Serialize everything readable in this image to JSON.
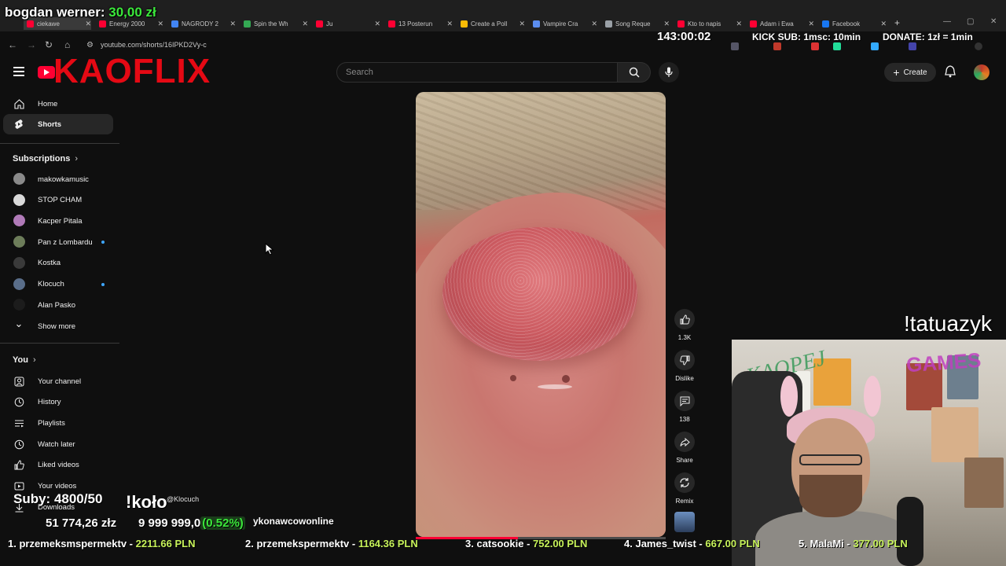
{
  "browser": {
    "tabs": [
      {
        "label": "ciekawe",
        "color": "#ff0033",
        "active": true
      },
      {
        "label": "Energy 2000",
        "color": "#ff0033"
      },
      {
        "label": "NAGRODY 2",
        "color": "#4285f4"
      },
      {
        "label": "Spin the Wh",
        "color": "#34a853"
      },
      {
        "label": "Ju",
        "color": "#ff0033"
      },
      {
        "label": "13 Posterun",
        "color": "#ff0033"
      },
      {
        "label": "Create a Poll",
        "color": "#fbbc05"
      },
      {
        "label": "Vampire Cra",
        "color": "#5b8def"
      },
      {
        "label": "Song Reque",
        "color": "#9aa0a6"
      },
      {
        "label": "Kto to napis",
        "color": "#ff0033"
      },
      {
        "label": "Adam i Ewa",
        "color": "#ff0033"
      },
      {
        "label": "Facebook",
        "color": "#1877f2"
      }
    ],
    "url": "youtube.com/shorts/16IPKD2Vy-c"
  },
  "header": {
    "brand_overlay": "KAOFLIX",
    "search_placeholder": "Search",
    "create_label": "Create"
  },
  "sidebar": {
    "main": [
      {
        "label": "Home",
        "icon": "home-icon"
      },
      {
        "label": "Shorts",
        "icon": "shorts-icon",
        "active": true
      }
    ],
    "subscriptions_heading": "Subscriptions",
    "subscriptions": [
      {
        "label": "makowkamusic",
        "color": "#8a8a8a",
        "live": false
      },
      {
        "label": "STOP CHAM",
        "color": "#d9d9d9",
        "live": false
      },
      {
        "label": "Kacper Pitala",
        "color": "#b07ab8",
        "live": false
      },
      {
        "label": "Pan z Lombardu",
        "color": "#6d7d5a",
        "live": true
      },
      {
        "label": "Kostka",
        "color": "#3a3a3a",
        "live": false
      },
      {
        "label": "Klocuch",
        "color": "#5a6e8a",
        "live": true
      },
      {
        "label": "Alan Pasko",
        "color": "#1c1c1c",
        "live": false
      }
    ],
    "show_more_label": "Show more",
    "you_heading": "You",
    "you_items": [
      {
        "label": "Your channel",
        "icon": "channel-icon"
      },
      {
        "label": "History",
        "icon": "history-icon"
      },
      {
        "label": "Playlists",
        "icon": "playlists-icon"
      },
      {
        "label": "Watch later",
        "icon": "watch-later-icon"
      },
      {
        "label": "Liked videos",
        "icon": "like-icon"
      },
      {
        "label": "Your videos",
        "icon": "your-videos-icon"
      },
      {
        "label": "Downloads",
        "icon": "download-icon"
      }
    ]
  },
  "short": {
    "likes": "1.3K",
    "dislike_label": "Dislike",
    "comments": "138",
    "share_label": "Share",
    "remix_label": "Remix",
    "progress_fraction": 0.41
  },
  "overlay": {
    "donor_name": "bogdan werner:",
    "donor_amount": "30,00 zł",
    "timer": "143:00:02",
    "kick_sub": "KICK SUB: 1msc: 10min",
    "donate_rate": "DONATE: 1zł = 1min",
    "command": "!tatuazyk",
    "subs": "Suby: 4800/50",
    "koto": "!koło",
    "author_handle": "@Klocuch",
    "money": "51 774,26 złz",
    "goal": "9 999 999,0",
    "goal_pct": "(0.52%)",
    "site": "ykonawcowonline",
    "webcam_wall_left": "KAOPEJ",
    "webcam_wall_right": "GAMES",
    "leaderboard": [
      {
        "rank": "1.",
        "name": "przemeksmspermektv",
        "value": "2211.66 PLN"
      },
      {
        "rank": "2.",
        "name": "przemekspermektv",
        "value": "1164.36 PLN"
      },
      {
        "rank": "3.",
        "name": "catsookie",
        "value": "752.00 PLN"
      },
      {
        "rank": "4.",
        "name": "James_twist",
        "value": "667.00 PLN"
      },
      {
        "rank": "5.",
        "name": "MalaMi",
        "value": "377.00 PLN"
      }
    ]
  }
}
